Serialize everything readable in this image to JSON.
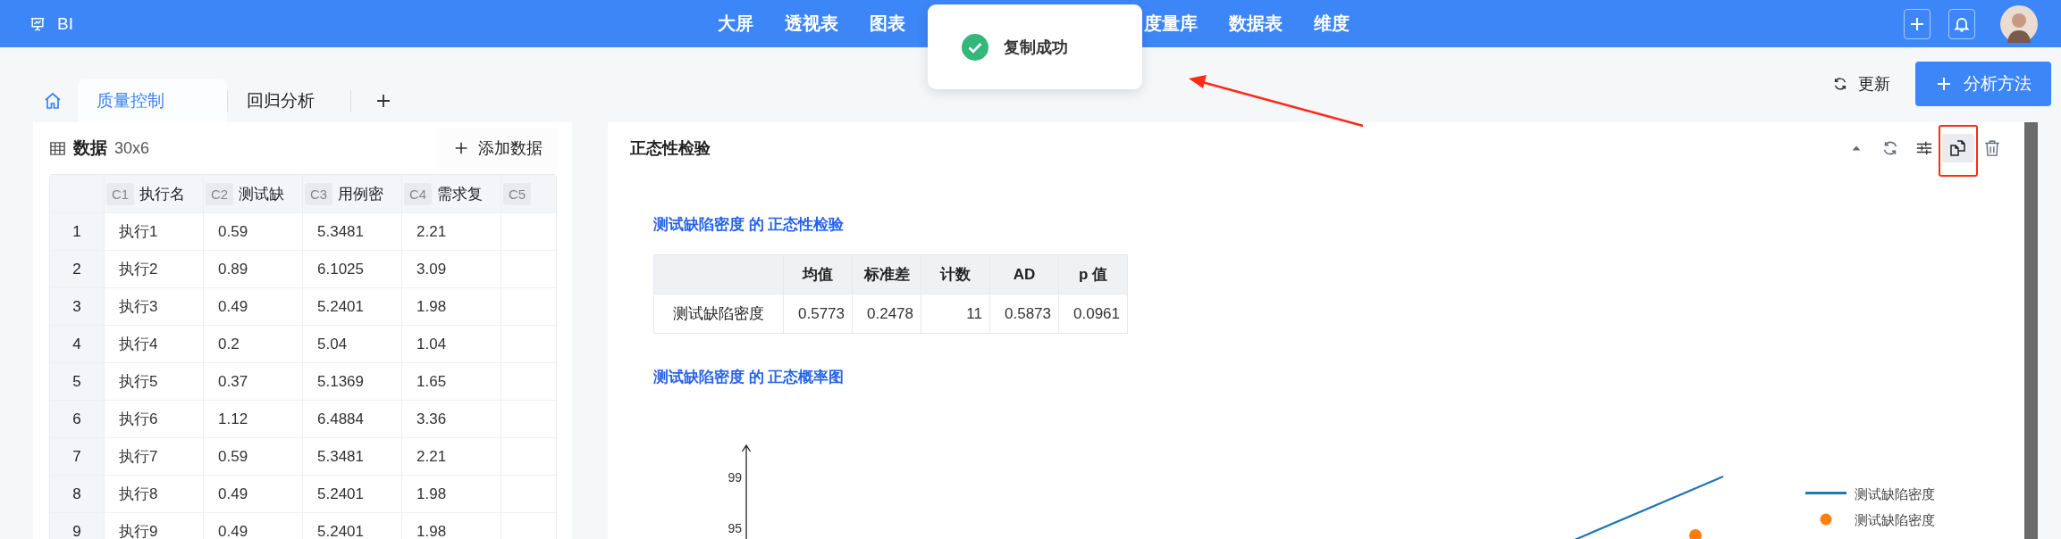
{
  "app": {
    "name": "BI"
  },
  "nav": [
    {
      "label": "大屏"
    },
    {
      "label": "透视表"
    },
    {
      "label": "图表"
    },
    {
      "label": "度量库"
    },
    {
      "label": "数据表"
    },
    {
      "label": "维度"
    }
  ],
  "toast": {
    "text": "复制成功"
  },
  "tabs": [
    {
      "label": "质量控制",
      "selected": true
    },
    {
      "label": "回归分析",
      "selected": false
    }
  ],
  "toolbar": {
    "refresh": "更新",
    "primary": "分析方法"
  },
  "data_panel": {
    "title": "数据",
    "size": "30x6",
    "add_button": "添加数据",
    "columns": [
      {
        "tag": "C1",
        "name": "执行名"
      },
      {
        "tag": "C2",
        "name": "测试缺"
      },
      {
        "tag": "C3",
        "name": "用例密"
      },
      {
        "tag": "C4",
        "name": "需求复"
      },
      {
        "tag": "C5"
      }
    ],
    "rows": [
      {
        "index": "1",
        "cells": [
          "执行1",
          "0.59",
          "5.3481",
          "2.21"
        ]
      },
      {
        "index": "2",
        "cells": [
          "执行2",
          "0.89",
          "6.1025",
          "3.09"
        ]
      },
      {
        "index": "3",
        "cells": [
          "执行3",
          "0.49",
          "5.2401",
          "1.98"
        ]
      },
      {
        "index": "4",
        "cells": [
          "执行4",
          "0.2",
          "5.04",
          "1.04"
        ]
      },
      {
        "index": "5",
        "cells": [
          "执行5",
          "0.37",
          "5.1369",
          "1.65"
        ]
      },
      {
        "index": "6",
        "cells": [
          "执行6",
          "1.12",
          "6.4884",
          "3.36"
        ]
      },
      {
        "index": "7",
        "cells": [
          "执行7",
          "0.59",
          "5.3481",
          "2.21"
        ]
      },
      {
        "index": "8",
        "cells": [
          "执行8",
          "0.49",
          "5.2401",
          "1.98"
        ]
      },
      {
        "index": "9",
        "cells": [
          "执行9",
          "0.49",
          "5.2401",
          "1.98"
        ]
      }
    ]
  },
  "result_panel": {
    "title": "正态性检验",
    "actions": [
      {
        "kind": "collapse",
        "active": false
      },
      {
        "kind": "refresh",
        "active": false
      },
      {
        "kind": "settings",
        "active": false
      },
      {
        "kind": "copy",
        "active": true
      },
      {
        "kind": "delete",
        "active": false
      }
    ],
    "test_heading": "测试缺陷密度 的 正态性检验",
    "stats": {
      "columns": [
        "均值",
        "标准差",
        "计数",
        "AD",
        "p 值"
      ],
      "rows": [
        {
          "label": "测试缺陷密度",
          "values": [
            "0.5773",
            "0.2478",
            "11",
            "0.5873",
            "0.0961"
          ]
        }
      ]
    },
    "plot_heading": "测试缺陷密度 的 正态概率图",
    "plot": {
      "yticks": [
        "99",
        "95"
      ],
      "legend": [
        {
          "label": "测试缺陷密度",
          "kind": "line",
          "color": "#1f77b4"
        },
        {
          "label": "测试缺陷密度",
          "kind": "marker",
          "color": "#ff7f0e"
        }
      ]
    }
  }
}
